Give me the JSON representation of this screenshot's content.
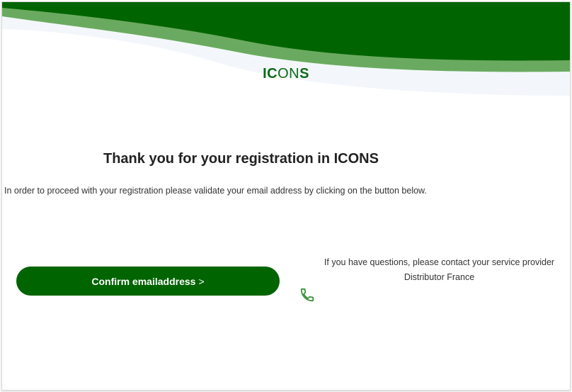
{
  "brand": {
    "logo_part1": "IC",
    "logo_part2": "ON",
    "logo_part3": "S",
    "primary_color": "#006400",
    "light_green": "#6aaa60"
  },
  "main": {
    "title": "Thank you for your registration in ICONS",
    "instructions": "In order to proceed with your registration please validate your email address by clicking on the button below.",
    "confirm_button_label": "Confirm emailaddress",
    "confirm_button_chevron": ">"
  },
  "contact": {
    "line1": "If you have questions, please contact your service provider",
    "line2": "Distributor France",
    "icon": "phone-icon"
  }
}
